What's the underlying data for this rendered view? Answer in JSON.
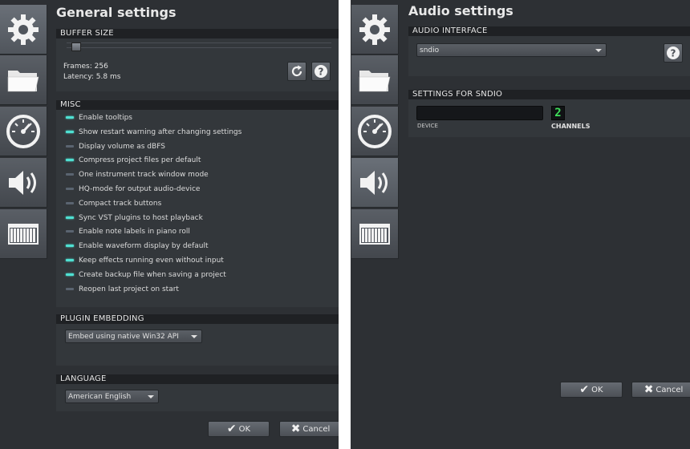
{
  "left": {
    "title": "General settings",
    "buffer": {
      "header": "BUFFER SIZE",
      "slider_fraction": 0.02,
      "frames_text": "Frames: 256",
      "latency_text": "Latency: 5.8 ms"
    },
    "misc": {
      "header": "MISC",
      "items": [
        {
          "label": "Enable tooltips",
          "on": true
        },
        {
          "label": "Show restart warning after changing settings",
          "on": true
        },
        {
          "label": "Display volume as dBFS",
          "on": false
        },
        {
          "label": "Compress project files per default",
          "on": true
        },
        {
          "label": "One instrument track window mode",
          "on": false
        },
        {
          "label": "HQ-mode for output audio-device",
          "on": false
        },
        {
          "label": "Compact track buttons",
          "on": false
        },
        {
          "label": "Sync VST plugins to host playback",
          "on": true
        },
        {
          "label": "Enable note labels in piano roll",
          "on": false
        },
        {
          "label": "Enable waveform display by default",
          "on": true
        },
        {
          "label": "Keep effects running even without input",
          "on": true
        },
        {
          "label": "Create backup file when saving a project",
          "on": true
        },
        {
          "label": "Reopen last project on start",
          "on": false
        }
      ]
    },
    "plugin": {
      "header": "PLUGIN EMBEDDING",
      "value": "Embed using native Win32 API"
    },
    "language": {
      "header": "LANGUAGE",
      "value": "American English"
    },
    "ok_label": "OK",
    "cancel_label": "Cancel"
  },
  "right": {
    "title": "Audio settings",
    "interface": {
      "header": "AUDIO INTERFACE",
      "value": "sndio"
    },
    "sndio": {
      "header": "SETTINGS FOR SNDIO",
      "device_label": "DEVICE",
      "device_value": "",
      "channels_value": "2",
      "channels_label": "CHANNELS"
    },
    "ok_label": "OK",
    "cancel_label": "Cancel"
  },
  "sidebar_tabs": [
    "gear-icon",
    "folder-icon",
    "gauge-icon",
    "speaker-icon",
    "keyboard-icon"
  ],
  "colors": {
    "led_on": "#4fe0d2",
    "led_off": "#5a6470",
    "lcd_digit": "#3fe05a",
    "pane_bg": "#2d3034",
    "header_bg": "#1f2124"
  }
}
